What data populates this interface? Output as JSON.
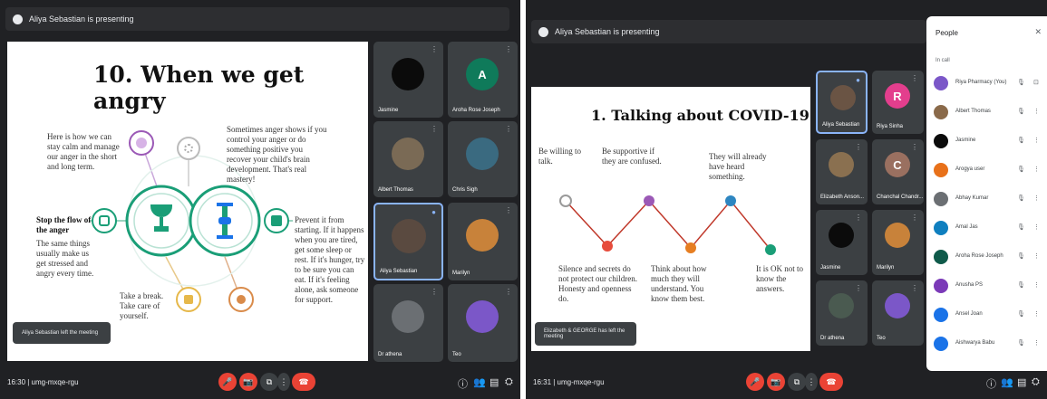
{
  "meeting_a": {
    "presenting_label": "Aliya Sebastian is presenting",
    "slide": {
      "title": "10. When we get angry",
      "texts": {
        "top_left": "Here is how we can stay calm and manage our anger in the short and long term.",
        "top_right": "Sometimes anger shows if you control your anger or do something positive you recover your child's brain development. That's real mastery!",
        "mid_left_title": "Stop the flow of the anger",
        "mid_left_body": "The same things usually make us get stressed and angry every time.",
        "mid_right": "Prevent it from starting. If it happens when you are tired, get some sleep or rest. If it's hunger, try to be sure you can eat. If it's feeling alone, ask someone for support.",
        "bottom_mid": "Take a break. Take care of yourself."
      }
    },
    "toast": "Aliya Sebastian left the meeting",
    "tiles": [
      {
        "name": "Jasmine",
        "avatar_color": "#0b0b0b",
        "initial": ""
      },
      {
        "name": "Aroha Rose Joseph",
        "avatar_color": "#0f7a5a",
        "initial": "A"
      },
      {
        "name": "Albert Thomas",
        "avatar_color": "#7a6a55",
        "initial": ""
      },
      {
        "name": "Chris Sigh",
        "avatar_color": "#3a6a80",
        "initial": ""
      },
      {
        "name": "Aliya Sebastian",
        "avatar_color": "#5a4a40",
        "initial": ""
      },
      {
        "name": "Marilyn",
        "avatar_color": "#c8823a",
        "initial": ""
      },
      {
        "name": "Dr athena",
        "avatar_color": "#6b6f73",
        "initial": ""
      },
      {
        "name": "Teo",
        "avatar_color": "#7b57c8",
        "initial": ""
      }
    ],
    "clock": "16:30 | umg-mxqe-rgu"
  },
  "meeting_b": {
    "presenting_label": "Aliya Sebastian is presenting",
    "slide": {
      "title": "1. Talking about COVID-19",
      "texts": {
        "t1": "Be willing to talk.",
        "t2": "Be supportive if they are confused.",
        "t3": "They will already have heard something.",
        "b1": "Silence and secrets do not protect our children. Honesty and openness do.",
        "b2": "Think about how much they will understand. You know them best.",
        "b3": "It is OK not to know the answers."
      }
    },
    "toast": "Elizabeth & GEORGE has left the meeting",
    "tiles": [
      {
        "name": "Aliya Sebastian",
        "avatar_color": "#6a5444",
        "initial": ""
      },
      {
        "name": "Riya Sinha",
        "avatar_color": "#e33e8d",
        "initial": "R"
      },
      {
        "name": "Elizabeth Anson...",
        "avatar_color": "#8a7050",
        "initial": ""
      },
      {
        "name": "Chanchal Chandr...",
        "avatar_color": "#9a7060",
        "initial": "C"
      },
      {
        "name": "Jasmine",
        "avatar_color": "#0b0b0b",
        "initial": ""
      },
      {
        "name": "Marilyn",
        "avatar_color": "#c8823a",
        "initial": ""
      },
      {
        "name": "Dr athena",
        "avatar_color": "#4a5a50",
        "initial": ""
      },
      {
        "name": "Teo",
        "avatar_color": "#7b57c8",
        "initial": ""
      }
    ],
    "clock": "16:31 | umg-mxqe-rgu"
  },
  "people_panel": {
    "title": "People",
    "section": "In call",
    "close_icon": "close-icon",
    "rows": [
      {
        "name": "Riya Pharmacy (You)",
        "color": "#7b57c8"
      },
      {
        "name": "Albert Thomas",
        "color": "#8a6a4a"
      },
      {
        "name": "Jasmine",
        "color": "#0b0b0b"
      },
      {
        "name": "Arogya user",
        "color": "#e8711a"
      },
      {
        "name": "Abhay Kumar",
        "color": "#6b6f73"
      },
      {
        "name": "Amal Jas",
        "color": "#0f7fbf"
      },
      {
        "name": "Aroha Rose Joseph",
        "color": "#0f5a4a"
      },
      {
        "name": "Anusha PS",
        "color": "#7b3ab8"
      },
      {
        "name": "Ansel Joan",
        "color": "#1a73e8"
      },
      {
        "name": "Aishwarya Babu",
        "color": "#1a73e8"
      }
    ]
  },
  "colors": {
    "meet_bg": "#202124",
    "tile_bg": "#3c4043",
    "hangup": "#ea4335",
    "accent": "#8ab4f8",
    "teal": "#1a9e77",
    "purple": "#9b59b6",
    "orange": "#e67e22"
  }
}
